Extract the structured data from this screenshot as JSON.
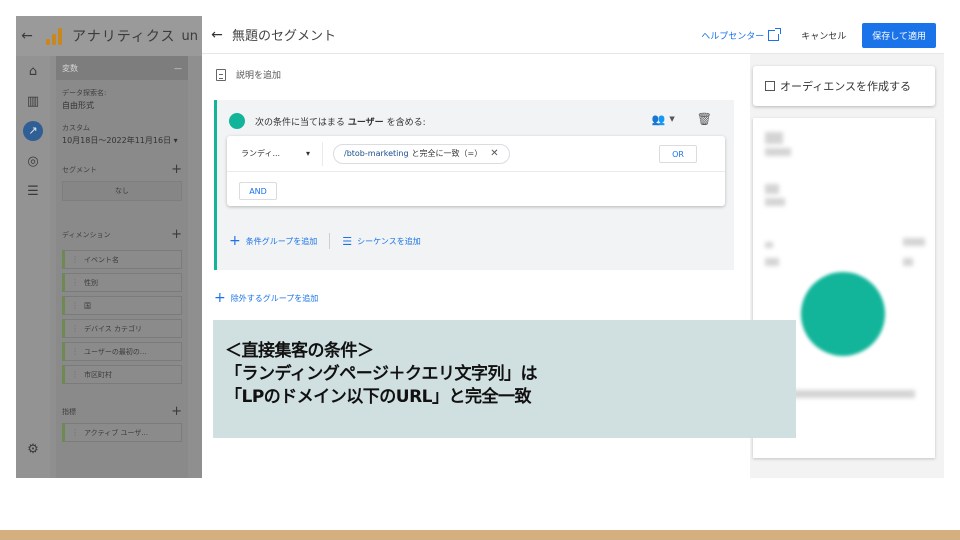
{
  "colors": {
    "accent": "#1a73e8",
    "teal": "#12b59a",
    "bottom_band": "#d5b07f",
    "annotation_bg": "#d0dfe0"
  },
  "background_app": {
    "title": "アナリティクス",
    "title_extra": "un",
    "panel_header": "変数",
    "exploration_label": "データ探索名:",
    "exploration_value": "自由形式",
    "date_label": "カスタム",
    "date_value": "10月18日～2022年11月16日 ▾",
    "segment_label": "セグメント",
    "segment_none": "なし",
    "dimension_label": "ディメンション",
    "dimensions": [
      "イベント名",
      "性別",
      "国",
      "デバイス カテゴリ",
      "ユーザーの最初の...",
      "市区町村"
    ],
    "metrics_label": "指標",
    "metrics": [
      "アクティブ ユーザ..."
    ]
  },
  "header": {
    "title": "無題のセグメント",
    "help_center": "ヘルプセンター",
    "cancel": "キャンセル",
    "save": "保存して適用"
  },
  "segment": {
    "description_prompt": "説明を追加",
    "condition_prefix": "次の条件に当てはまる",
    "condition_scope": "ユーザー",
    "condition_suffix": "を含める:",
    "dimension": "ランディ...",
    "filter_value": "/btob-marketing",
    "filter_op": "と完全に一致（=）",
    "or_label": "OR",
    "and_label": "AND",
    "add_condition_group": "条件グループを追加",
    "add_sequence": "シーケンスを追加",
    "add_exclude_group": "除外するグループを追加"
  },
  "right_panel": {
    "create_audience": "オーディエンスを作成する"
  },
  "annotation": {
    "line1": "＜直接集客の条件＞",
    "line2": "「ランディングページ＋クエリ文字列」は",
    "line3": "「LPのドメイン以下のURL」と完全一致"
  }
}
